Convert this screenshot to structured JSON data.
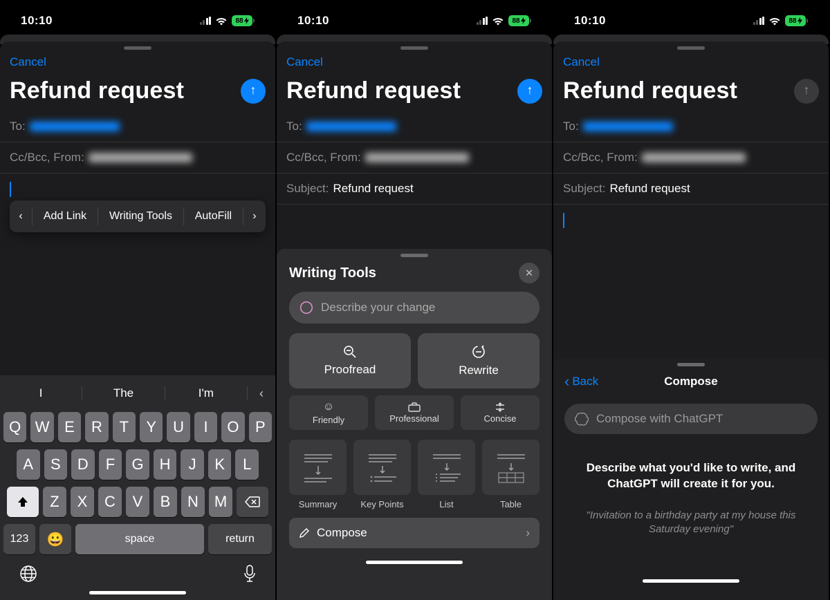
{
  "status": {
    "time": "10:10",
    "battery": "88"
  },
  "compose": {
    "cancel": "Cancel",
    "title": "Refund request",
    "to_label": "To:",
    "ccbcc_label": "Cc/Bcc, From:",
    "subject_label": "Subject:",
    "subject_value": "Refund request"
  },
  "quickbar": {
    "add_link": "Add Link",
    "writing_tools": "Writing Tools",
    "autofill": "AutoFill"
  },
  "predictions": {
    "p1": "I",
    "p2": "The",
    "p3": "I'm"
  },
  "keys": {
    "row1": [
      "Q",
      "W",
      "E",
      "R",
      "T",
      "Y",
      "U",
      "I",
      "O",
      "P"
    ],
    "row2": [
      "A",
      "S",
      "D",
      "F",
      "G",
      "H",
      "J",
      "K",
      "L"
    ],
    "row3": [
      "Z",
      "X",
      "C",
      "V",
      "B",
      "N",
      "M"
    ],
    "num": "123",
    "space": "space",
    "return": "return"
  },
  "wt": {
    "title": "Writing Tools",
    "placeholder": "Describe your change",
    "proofread": "Proofread",
    "rewrite": "Rewrite",
    "friendly": "Friendly",
    "professional": "Professional",
    "concise": "Concise",
    "summary": "Summary",
    "keypoints": "Key Points",
    "list": "List",
    "table": "Table",
    "compose": "Compose"
  },
  "cp": {
    "back": "Back",
    "title": "Compose",
    "placeholder": "Compose with ChatGPT",
    "desc": "Describe what you'd like to write, and ChatGPT will create it for you.",
    "example": "\"Invitation to a birthday party at my house this Saturday evening\""
  }
}
